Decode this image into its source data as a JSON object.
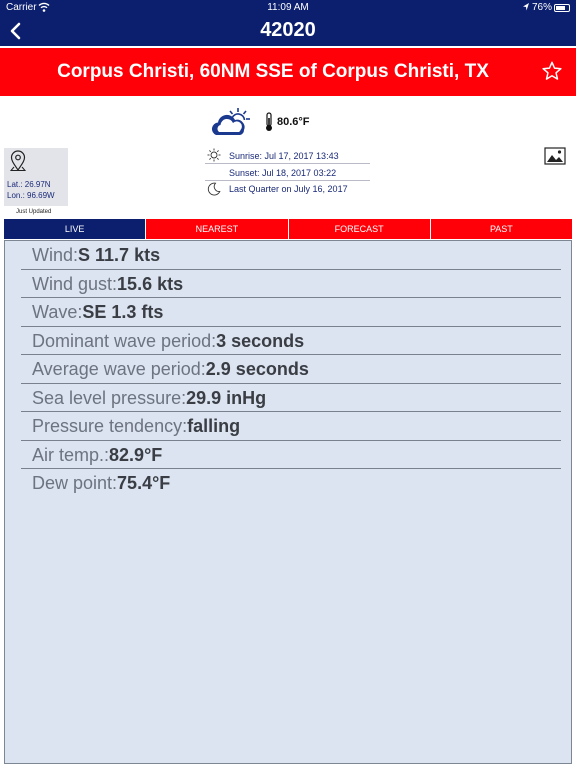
{
  "status_bar": {
    "carrier": "Carrier",
    "time": "11:09 AM",
    "battery": "76%",
    "battery_level": 0.76
  },
  "nav": {
    "title": "42020",
    "back_icon": "chevron-left-icon"
  },
  "station": {
    "name": "Corpus Christi, 60NM SSE of Corpus Christi, TX",
    "favorite_icon": "star-outline-icon"
  },
  "weather": {
    "condition_icon": "partly-cloudy-icon",
    "temperature": "80.6°F"
  },
  "location": {
    "lat": "Lat.: 26.97N",
    "lon": "Lon.: 96.69W",
    "updated": "Just Updated"
  },
  "sun": {
    "sunrise": "Sunrise: Jul 17, 2017 13:43",
    "sunset": "Sunset:  Jul 18, 2017 03:22",
    "moon": "Last Quarter on July 16, 2017"
  },
  "tabs": [
    {
      "label": "LIVE",
      "active": true
    },
    {
      "label": "NEAREST",
      "active": false
    },
    {
      "label": "FORECAST",
      "active": false
    },
    {
      "label": "PAST",
      "active": false
    }
  ],
  "observations": [
    {
      "label": "Wind:",
      "value": "S 11.7 kts"
    },
    {
      "label": "Wind gust:",
      "value": "15.6 kts"
    },
    {
      "label": "Wave:",
      "value": "SE 1.3 fts"
    },
    {
      "label": "Dominant wave period:",
      "value": "3 seconds"
    },
    {
      "label": "Average wave period:",
      "value": "2.9 seconds"
    },
    {
      "label": "Sea level pressure:",
      "value": "29.9 inHg"
    },
    {
      "label": "Pressure tendency:",
      "value": "falling"
    },
    {
      "label": "Air temp.:",
      "value": "82.9°F"
    },
    {
      "label": "Dew point:",
      "value": "75.4°F"
    }
  ],
  "colors": {
    "navy": "#0c1f6e",
    "red": "#ff0009",
    "panel": "#dbe4f0"
  }
}
